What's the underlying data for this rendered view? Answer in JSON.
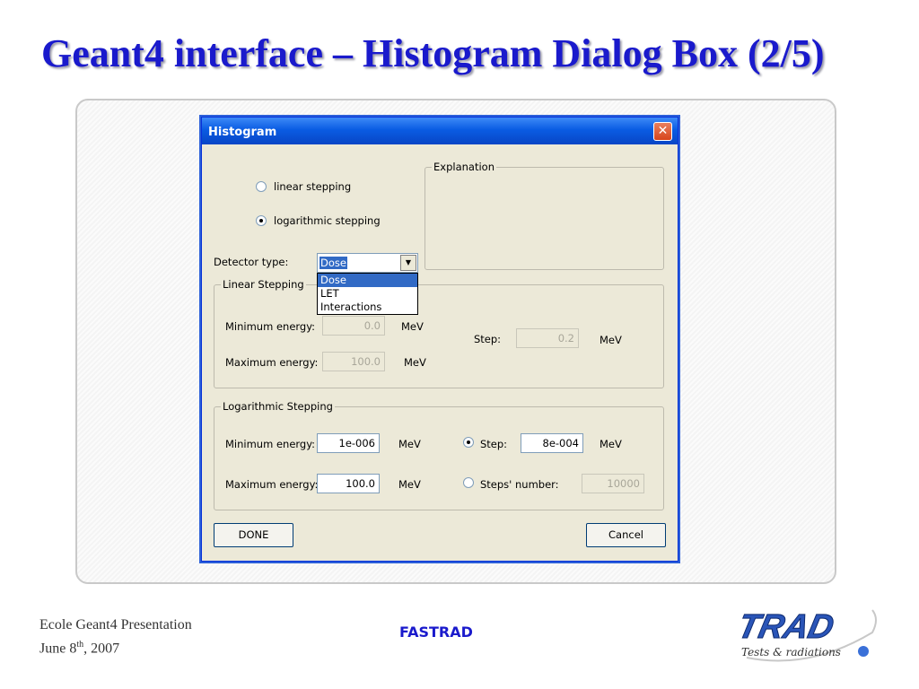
{
  "slide": {
    "title": "Geant4 interface – Histogram Dialog Box (2/5)",
    "footer_line1": "Ecole Geant4 Presentation",
    "footer_line2_prefix": "June 8",
    "footer_line2_sup": "th",
    "footer_line2_suffix": ", 2007",
    "footer_center": "FASTRAD",
    "logo_text": "TRAD",
    "logo_tagline": "Tests & radiations"
  },
  "dialog": {
    "title": "Histogram",
    "close_symbol": "✕",
    "stepping_options": [
      {
        "label": "linear stepping",
        "selected": false
      },
      {
        "label": "logarithmic stepping",
        "selected": true
      }
    ],
    "explanation_label": "Explanation",
    "detector_type": {
      "label": "Detector type:",
      "value": "Dose",
      "options": [
        "Dose",
        "LET",
        "Interactions"
      ]
    },
    "linear_stepping": {
      "label": "Linear Stepping",
      "min_label": "Minimum energy:",
      "min_value": "0.0",
      "max_label": "Maximum energy:",
      "max_value": "100.0",
      "step_label": "Step:",
      "step_value": "0.2",
      "unit": "MeV"
    },
    "log_stepping": {
      "label": "Logarithmic Stepping",
      "min_label": "Minimum energy:",
      "min_value": "1e-006",
      "max_label": "Maximum energy:",
      "max_value": "100.0",
      "step_label": "Step:",
      "step_value": "8e-004",
      "steps_number_label": "Steps' number:",
      "steps_number_value": "10000",
      "unit": "MeV"
    },
    "done_label": "DONE",
    "cancel_label": "Cancel"
  }
}
